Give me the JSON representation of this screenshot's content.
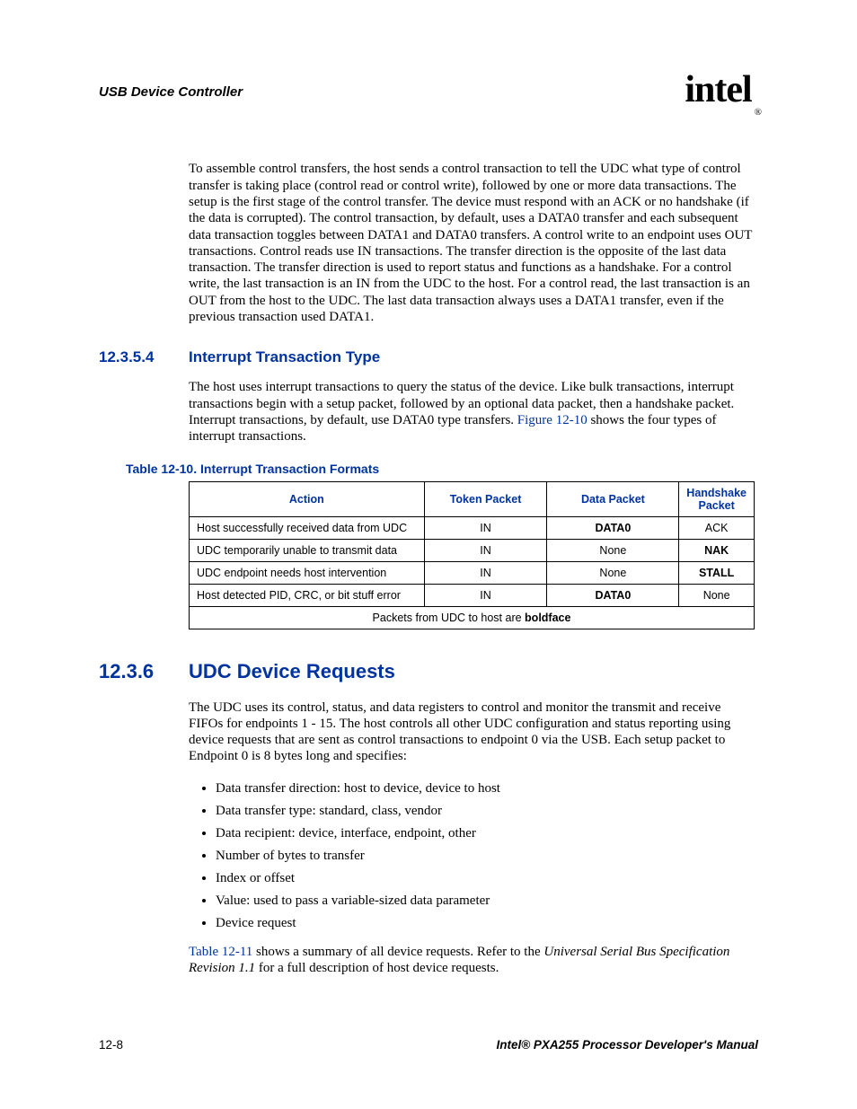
{
  "header": {
    "title": "USB Device Controller",
    "logo_text": "intel",
    "logo_reg": "®"
  },
  "para1": "To assemble control transfers, the host sends a control transaction to tell the UDC what type of control transfer is taking place (control read or control write), followed by one or more data transactions. The setup is the first stage of the control transfer. The device must respond with an ACK or no handshake (if the data is corrupted). The control transaction, by default, uses a DATA0 transfer and each subsequent data transaction toggles between DATA1 and DATA0 transfers. A control write to an endpoint uses OUT transactions. Control reads use IN transactions. The transfer direction is the opposite of the last data transaction. The transfer direction is used to report status and functions as a handshake. For a control write, the last transaction is an IN from the UDC to the host. For a control read, the last transaction is an OUT from the host to the UDC. The last data transaction always uses a DATA1 transfer, even if the previous transaction used DATA1.",
  "sec12354": {
    "num": "12.3.5.4",
    "title": "Interrupt Transaction Type",
    "para_a": "The host uses interrupt transactions to query the status of the device. Like bulk transactions, interrupt transactions begin with a setup packet, followed by an optional data packet, then a handshake packet. Interrupt transactions, by default, use DATA0 type transfers. ",
    "xref": "Figure 12-10",
    "para_b": " shows the four types of interrupt transactions."
  },
  "table": {
    "caption": "Table 12-10. Interrupt Transaction Formats",
    "headers": [
      "Action",
      "Token Packet",
      "Data Packet",
      "Handshake Packet"
    ],
    "rows": [
      {
        "action": "Host successfully received data from UDC",
        "token": "IN",
        "data": "DATA0",
        "data_bold": true,
        "hs": "ACK",
        "hs_bold": false
      },
      {
        "action": "UDC temporarily unable to transmit data",
        "token": "IN",
        "data": "None",
        "data_bold": false,
        "hs": "NAK",
        "hs_bold": true
      },
      {
        "action": "UDC endpoint needs host intervention",
        "token": "IN",
        "data": "None",
        "data_bold": false,
        "hs": "STALL",
        "hs_bold": true
      },
      {
        "action": "Host detected PID, CRC, or bit stuff error",
        "token": "IN",
        "data": "DATA0",
        "data_bold": true,
        "hs": "None",
        "hs_bold": false
      }
    ],
    "footnote_before": "Packets from UDC to host are ",
    "footnote_bold": "boldface"
  },
  "sec1236": {
    "num": "12.3.6",
    "title": "UDC Device Requests",
    "para": "The UDC uses its control, status, and data registers to control and monitor the transmit and receive FIFOs for endpoints 1 - 15. The host controls all other UDC configuration and status reporting using device requests that are sent as control transactions to endpoint 0 via the USB. Each setup packet to Endpoint 0 is 8 bytes long and specifies:",
    "bullets": [
      "Data transfer direction: host to device, device to host",
      "Data transfer type: standard, class, vendor",
      "Data recipient: device, interface, endpoint, other",
      "Number of bytes to transfer",
      "Index or offset",
      "Value: used to pass a variable-sized data parameter",
      "Device request"
    ],
    "para2_xref": "Table 12-11",
    "para2_a": " shows a summary of all device requests. Refer to the ",
    "para2_em": "Universal Serial Bus Specification Revision 1.1",
    "para2_b": " for a full description of host device requests."
  },
  "footer": {
    "page": "12-8",
    "doc": "Intel® PXA255 Processor Developer's Manual"
  }
}
